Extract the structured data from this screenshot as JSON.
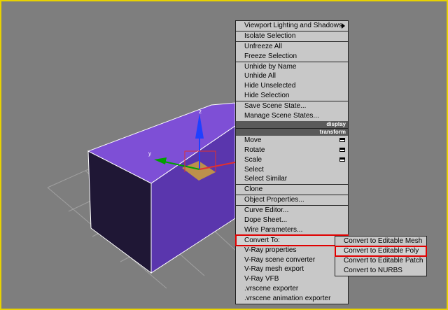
{
  "context_menu": {
    "display_section": {
      "header": "display",
      "items": [
        {
          "label": "Viewport Lighting and Shadows",
          "has_submenu": true
        },
        {
          "label": "Isolate Selection"
        },
        {
          "label": "Unfreeze All"
        },
        {
          "label": "Freeze Selection"
        },
        {
          "label": "Unhide by Name"
        },
        {
          "label": "Unhide All"
        },
        {
          "label": "Hide Unselected"
        },
        {
          "label": "Hide Selection"
        },
        {
          "label": "Save Scene State..."
        },
        {
          "label": "Manage Scene States..."
        }
      ]
    },
    "transform_section": {
      "header": "transform",
      "items": [
        {
          "label": "Move",
          "has_options": true
        },
        {
          "label": "Rotate",
          "has_options": true
        },
        {
          "label": "Scale",
          "has_options": true
        },
        {
          "label": "Select"
        },
        {
          "label": "Select Similar"
        },
        {
          "label": "Clone"
        },
        {
          "label": "Object Properties..."
        },
        {
          "label": "Curve Editor..."
        },
        {
          "label": "Dope Sheet..."
        },
        {
          "label": "Wire Parameters..."
        },
        {
          "label": "Convert To:",
          "has_submenu": true,
          "highlighted": true
        },
        {
          "label": "V-Ray properties"
        },
        {
          "label": "V-Ray scene converter"
        },
        {
          "label": "V-Ray mesh export"
        },
        {
          "label": "V-Ray VFB"
        },
        {
          "label": ".vrscene exporter"
        },
        {
          "label": ".vrscene animation exporter"
        }
      ]
    }
  },
  "convert_submenu": {
    "items": [
      {
        "label": "Convert to Editable Mesh"
      },
      {
        "label": "Convert to Editable Poly",
        "highlighted": true
      },
      {
        "label": "Convert to Editable Patch"
      },
      {
        "label": "Convert to NURBS"
      }
    ]
  },
  "gizmo": {
    "z_label": "z",
    "y_label": "y"
  },
  "colors": {
    "viewport_border": "#e8d200",
    "box_top": "#7e4fd6",
    "box_front": "#5a36ad",
    "box_side": "#1f1735",
    "highlight_outline": "#e00000"
  }
}
